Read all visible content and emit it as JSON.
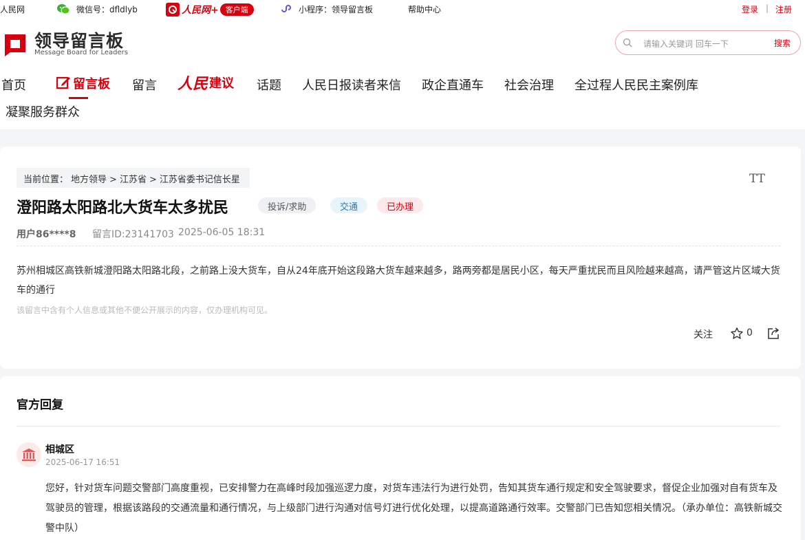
{
  "topbar": {
    "site": "人民网",
    "wechat_label": "微信号：dfldlyb",
    "app_brand": "人民网+",
    "app_pill": "客户端",
    "mini_program": "小程序：领导留言板",
    "help": "帮助中心",
    "login": "登录",
    "sep": "|",
    "register": "注册"
  },
  "header": {
    "logo_cn": "领导留言板",
    "logo_en": "Message Board for Leaders",
    "search_placeholder": "请输入关键词 回车一下",
    "search_button": "搜索"
  },
  "nav": {
    "home": "首页",
    "board": "留言板",
    "message": "留言",
    "rmjy_a": "人民",
    "rmjy_b": "建议",
    "topics": "话题",
    "readers": "人民日报读者来信",
    "enterprise": "政企直通车",
    "governance": "社会治理",
    "cases": "全过程人民民主案例库",
    "service": "凝聚服务群众"
  },
  "post": {
    "breadcrumb": [
      "当前位置：",
      "地方领导",
      ">",
      "江苏省",
      ">",
      "江苏省委书记信长星"
    ],
    "font_toggle": "TT",
    "title": "澄阳路太阳路北大货车太多扰民",
    "tags": [
      "投诉/求助",
      "交通",
      "已办理"
    ],
    "user": "用户86****8",
    "message_id": "留言ID:23141703",
    "datetime": "2025-06-05 18:31",
    "content": "苏州相城区高铁新城澄阳路太阳路北段，之前路上没大货车，自从24年底开始这段路大货车越来越多，路两旁都是居民小区，每天严重扰民而且风险越来越高，请严管这片区域大货车的通行",
    "privacy_notice": "该留言中含有个人信息或其他不便公开展示的内容，仅办理机构可见。",
    "follow": "关注",
    "star_count": "0"
  },
  "reply": {
    "heading": "官方回复",
    "org": "相城区",
    "date": "2025-06-17 16:51",
    "content": "您好，针对货车问题交警部门高度重视，已安排警力在高峰时段加强巡逻力度，对货车违法行为进行处罚，告知其货车通行规定和安全驾驶要求，督促企业加强对自有货车及驾驶员的管理，根据该路段的交通流量和通行情况，与上级部门进行沟通对信号灯进行优化处理，以提高道路通行效率。交警部门已告知您相关情况。（承办单位：高铁新城交警中队）"
  },
  "colors": {
    "brand_red": "#d7000f",
    "tag_blue": "#2f7bb5"
  },
  "icons": [
    "wechat-icon",
    "mini-program-icon",
    "search-icon",
    "edit-icon",
    "star-icon",
    "share-icon",
    "bank-building-icon"
  ]
}
